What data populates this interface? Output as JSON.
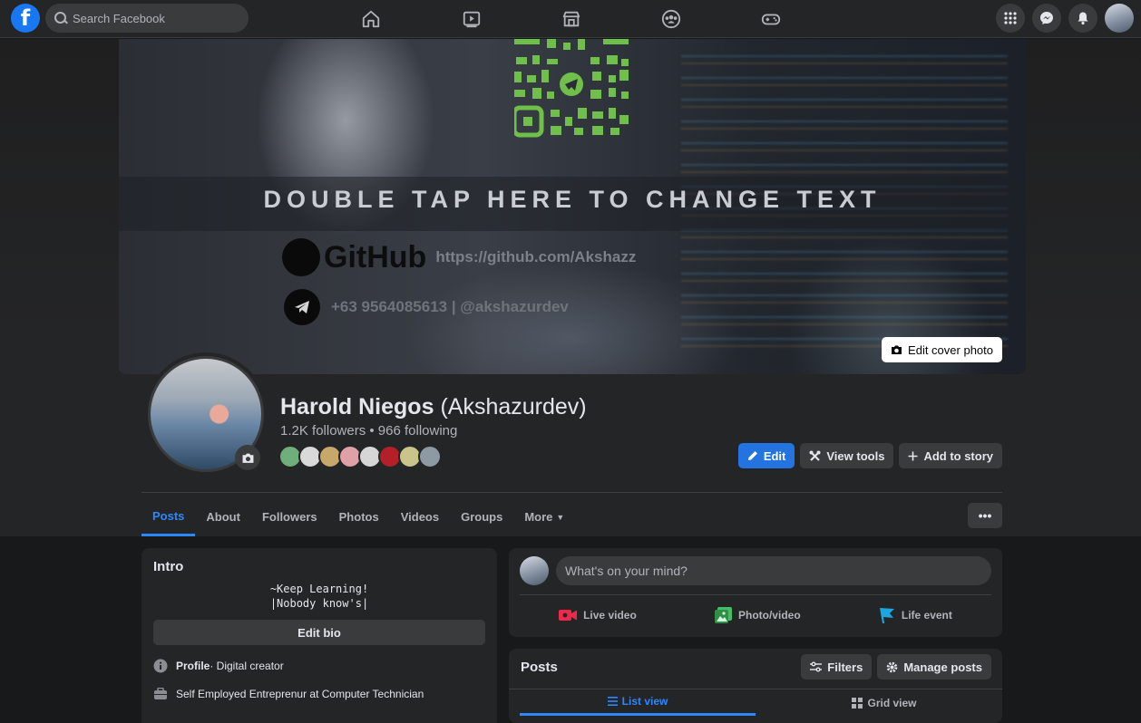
{
  "topnav": {
    "logo": "f",
    "search": {
      "placeholder": "Search Facebook"
    },
    "center_icons": [
      "home-icon",
      "watch-icon",
      "marketplace-icon",
      "groups-icon",
      "gaming-icon"
    ],
    "right_icons": [
      "menu-grid-icon",
      "messenger-icon",
      "notifications-icon"
    ]
  },
  "cover": {
    "overlay_text": "DOUBLE TAP HERE TO CHANGE TEXT",
    "github_word": "GitHub",
    "github_url": "https://github.com/Akshazz",
    "telegram_text": "+63 9564085613 | @akshazurdev",
    "edit_label": "Edit cover photo"
  },
  "profile": {
    "name": "Harold Niegos",
    "alt_name": "(Akshazurdev)",
    "stats": "1.2K followers • 966 following",
    "friend_avatar_colors": [
      "#6fae7a",
      "#d9d9d9",
      "#c7a76a",
      "#e0a0a8",
      "#d6d6d6",
      "#b3202a",
      "#c9c48a",
      "#8e9aa3"
    ],
    "actions": {
      "edit": "Edit",
      "view_tools": "View tools",
      "add_story": "Add to story"
    }
  },
  "tabs": [
    {
      "label": "Posts",
      "active": true
    },
    {
      "label": "About"
    },
    {
      "label": "Followers"
    },
    {
      "label": "Photos"
    },
    {
      "label": "Videos"
    },
    {
      "label": "Groups"
    },
    {
      "label": "More"
    }
  ],
  "more_dots": "•••",
  "intro": {
    "title": "Intro",
    "bio_line1": "~Keep Learning!",
    "bio_line2": "|Nobody know's|",
    "edit_bio": "Edit bio",
    "profile_label": "Profile",
    "profile_value": " · Digital creator",
    "work": "Self Employed Entreprenur at Computer Technician"
  },
  "composer": {
    "placeholder": "What's on your mind?",
    "live": "Live video",
    "photo": "Photo/video",
    "life": "Life event"
  },
  "posts": {
    "title": "Posts",
    "filters": "Filters",
    "manage": "Manage posts",
    "list_view": "List view",
    "grid_view": "Grid view"
  },
  "colors": {
    "accent": "#2d88ff",
    "primary_button": "#2374e1",
    "live": "#f02849",
    "photo": "#45bd62",
    "life": "#1ba5e1"
  }
}
